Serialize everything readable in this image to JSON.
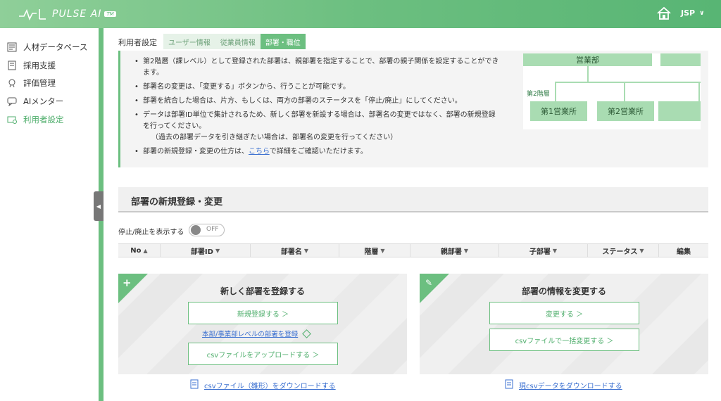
{
  "app": {
    "name": "PULSE AI",
    "tm": "TM",
    "user": "JSP"
  },
  "sidebar": {
    "items": [
      {
        "label": "人材データベース",
        "icon": "database-icon"
      },
      {
        "label": "採用支援",
        "icon": "document-icon"
      },
      {
        "label": "評価管理",
        "icon": "medal-icon"
      },
      {
        "label": "AIメンター",
        "icon": "chat-icon"
      },
      {
        "label": "利用者設定",
        "icon": "user-settings-icon",
        "active": true
      }
    ]
  },
  "settings": {
    "title": "利用者設定",
    "tabs": [
      "ユーザー情報",
      "従業員情報",
      "部署・職位"
    ]
  },
  "info": {
    "bullets": [
      "第2階層（課レベル）として登録された部署は、親部署を指定することで、部署の親子関係を設定することができます。",
      "部署名の変更は、「変更する」ボタンから、行うことが可能です。",
      "部署を統合した場合は、片方、もしくは、両方の部署のステータスを「停止/廃止」にしてください。",
      "データは部署ID単位で集計されるため、新しく部署を新設する場合は、部署名の変更ではなく、部署の新規登録を行ってください。"
    ],
    "bullet4_note": "（過去の部署データを引き継ぎたい場合は、部署名の変更を行ってください）",
    "bullet5_pre": "部署の新規登録・変更の仕方は、",
    "bullet5_link": "こちら",
    "bullet5_post": "で詳細をご確認いただけます。",
    "diagram": {
      "top_box": "営業部",
      "level_label": "第2階層",
      "child1": "第1営業所",
      "child2": "第2営業所"
    }
  },
  "section": {
    "title": "部署の新規登録・変更",
    "toggle_label": "停止/廃止を表示する",
    "toggle_state": "OFF"
  },
  "table": {
    "columns": [
      {
        "label": "No",
        "sort": "▲"
      },
      {
        "label": "部署ID",
        "sort": "▼"
      },
      {
        "label": "部署名",
        "sort": "▼"
      },
      {
        "label": "階層",
        "sort": "▼"
      },
      {
        "label": "親部署",
        "sort": "▼"
      },
      {
        "label": "子部署",
        "sort": "▼"
      },
      {
        "label": "ステータス",
        "sort": "▼"
      },
      {
        "label": "編集",
        "sort": ""
      }
    ]
  },
  "cards": {
    "new": {
      "title": "新しく部署を登録する",
      "btn_register": "新規登録する ＞",
      "link_hq": "本部/事業部レベルの部署を登録",
      "btn_csv_upload": "csvファイルをアップロードする ＞",
      "download": "csvファイル（雛形）をダウンロードする"
    },
    "edit": {
      "title": "部署の情報を変更する",
      "btn_change": "変更する ＞",
      "btn_csv_bulk": "csvファイルで一括変更する ＞",
      "download": "現csvデータをダウンロードする"
    }
  },
  "colors": {
    "accent": "#6cbf80",
    "link": "#3a6fd0"
  }
}
